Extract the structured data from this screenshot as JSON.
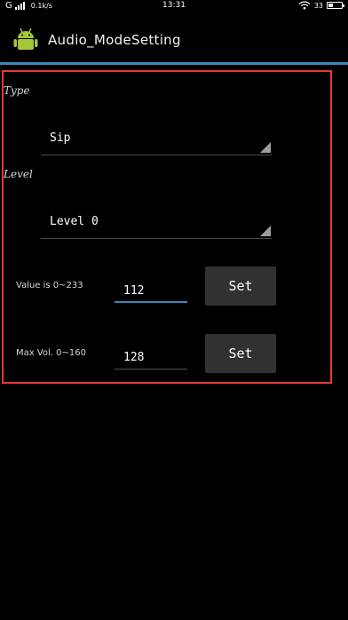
{
  "status_bar": {
    "carrier": "G",
    "net_speed": "0.1k/s",
    "time": "13:31",
    "battery_percent": "33",
    "battery_level": 0.33
  },
  "app": {
    "title": "Audio_ModeSetting",
    "icon": "android-robot-icon"
  },
  "form": {
    "type_label": "Type",
    "type_value": "Sip",
    "level_label": "Level",
    "level_value": "Level 0",
    "value_row": {
      "label": "Value is 0~233",
      "value": "112",
      "button": "Set"
    },
    "maxvol_row": {
      "label": "Max Vol. 0~160",
      "value": "128",
      "button": "Set"
    }
  },
  "colors": {
    "accent": "#3b88b8",
    "highlight": "#e53935",
    "button_bg": "#2f3133"
  }
}
